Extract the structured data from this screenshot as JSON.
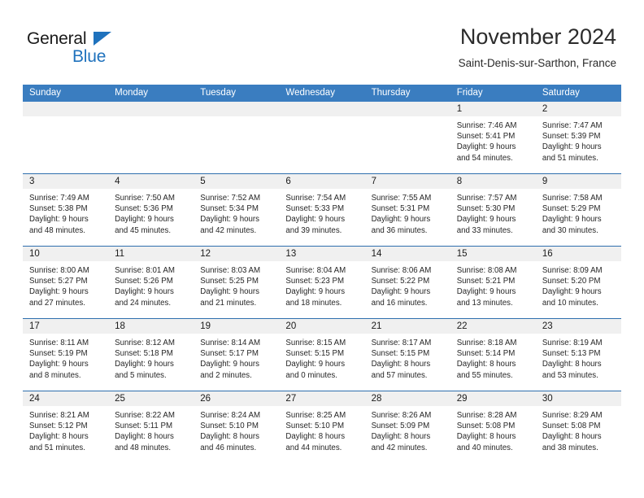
{
  "brand": {
    "line1": "General",
    "line2": "Blue",
    "icon": "triangle-logo"
  },
  "header": {
    "title": "November 2024",
    "subtitle": "Saint-Denis-sur-Sarthon, France"
  },
  "colors": {
    "header_blue": "#3a7dc0",
    "row_divider_blue": "#2f6fae",
    "daynum_band": "#f0f0f0",
    "brand_blue": "#1f72bd",
    "text": "#262626"
  },
  "calendar": {
    "weekdays": [
      "Sunday",
      "Monday",
      "Tuesday",
      "Wednesday",
      "Thursday",
      "Friday",
      "Saturday"
    ],
    "weeks": [
      [
        {
          "empty": true,
          "day": ""
        },
        {
          "empty": true,
          "day": ""
        },
        {
          "empty": true,
          "day": ""
        },
        {
          "empty": true,
          "day": ""
        },
        {
          "empty": true,
          "day": ""
        },
        {
          "empty": false,
          "day": "1",
          "sunrise": "Sunrise: 7:46 AM",
          "sunset": "Sunset: 5:41 PM",
          "daylight1": "Daylight: 9 hours",
          "daylight2": "and 54 minutes."
        },
        {
          "empty": false,
          "day": "2",
          "sunrise": "Sunrise: 7:47 AM",
          "sunset": "Sunset: 5:39 PM",
          "daylight1": "Daylight: 9 hours",
          "daylight2": "and 51 minutes."
        }
      ],
      [
        {
          "empty": false,
          "day": "3",
          "sunrise": "Sunrise: 7:49 AM",
          "sunset": "Sunset: 5:38 PM",
          "daylight1": "Daylight: 9 hours",
          "daylight2": "and 48 minutes."
        },
        {
          "empty": false,
          "day": "4",
          "sunrise": "Sunrise: 7:50 AM",
          "sunset": "Sunset: 5:36 PM",
          "daylight1": "Daylight: 9 hours",
          "daylight2": "and 45 minutes."
        },
        {
          "empty": false,
          "day": "5",
          "sunrise": "Sunrise: 7:52 AM",
          "sunset": "Sunset: 5:34 PM",
          "daylight1": "Daylight: 9 hours",
          "daylight2": "and 42 minutes."
        },
        {
          "empty": false,
          "day": "6",
          "sunrise": "Sunrise: 7:54 AM",
          "sunset": "Sunset: 5:33 PM",
          "daylight1": "Daylight: 9 hours",
          "daylight2": "and 39 minutes."
        },
        {
          "empty": false,
          "day": "7",
          "sunrise": "Sunrise: 7:55 AM",
          "sunset": "Sunset: 5:31 PM",
          "daylight1": "Daylight: 9 hours",
          "daylight2": "and 36 minutes."
        },
        {
          "empty": false,
          "day": "8",
          "sunrise": "Sunrise: 7:57 AM",
          "sunset": "Sunset: 5:30 PM",
          "daylight1": "Daylight: 9 hours",
          "daylight2": "and 33 minutes."
        },
        {
          "empty": false,
          "day": "9",
          "sunrise": "Sunrise: 7:58 AM",
          "sunset": "Sunset: 5:29 PM",
          "daylight1": "Daylight: 9 hours",
          "daylight2": "and 30 minutes."
        }
      ],
      [
        {
          "empty": false,
          "day": "10",
          "sunrise": "Sunrise: 8:00 AM",
          "sunset": "Sunset: 5:27 PM",
          "daylight1": "Daylight: 9 hours",
          "daylight2": "and 27 minutes."
        },
        {
          "empty": false,
          "day": "11",
          "sunrise": "Sunrise: 8:01 AM",
          "sunset": "Sunset: 5:26 PM",
          "daylight1": "Daylight: 9 hours",
          "daylight2": "and 24 minutes."
        },
        {
          "empty": false,
          "day": "12",
          "sunrise": "Sunrise: 8:03 AM",
          "sunset": "Sunset: 5:25 PM",
          "daylight1": "Daylight: 9 hours",
          "daylight2": "and 21 minutes."
        },
        {
          "empty": false,
          "day": "13",
          "sunrise": "Sunrise: 8:04 AM",
          "sunset": "Sunset: 5:23 PM",
          "daylight1": "Daylight: 9 hours",
          "daylight2": "and 18 minutes."
        },
        {
          "empty": false,
          "day": "14",
          "sunrise": "Sunrise: 8:06 AM",
          "sunset": "Sunset: 5:22 PM",
          "daylight1": "Daylight: 9 hours",
          "daylight2": "and 16 minutes."
        },
        {
          "empty": false,
          "day": "15",
          "sunrise": "Sunrise: 8:08 AM",
          "sunset": "Sunset: 5:21 PM",
          "daylight1": "Daylight: 9 hours",
          "daylight2": "and 13 minutes."
        },
        {
          "empty": false,
          "day": "16",
          "sunrise": "Sunrise: 8:09 AM",
          "sunset": "Sunset: 5:20 PM",
          "daylight1": "Daylight: 9 hours",
          "daylight2": "and 10 minutes."
        }
      ],
      [
        {
          "empty": false,
          "day": "17",
          "sunrise": "Sunrise: 8:11 AM",
          "sunset": "Sunset: 5:19 PM",
          "daylight1": "Daylight: 9 hours",
          "daylight2": "and 8 minutes."
        },
        {
          "empty": false,
          "day": "18",
          "sunrise": "Sunrise: 8:12 AM",
          "sunset": "Sunset: 5:18 PM",
          "daylight1": "Daylight: 9 hours",
          "daylight2": "and 5 minutes."
        },
        {
          "empty": false,
          "day": "19",
          "sunrise": "Sunrise: 8:14 AM",
          "sunset": "Sunset: 5:17 PM",
          "daylight1": "Daylight: 9 hours",
          "daylight2": "and 2 minutes."
        },
        {
          "empty": false,
          "day": "20",
          "sunrise": "Sunrise: 8:15 AM",
          "sunset": "Sunset: 5:15 PM",
          "daylight1": "Daylight: 9 hours",
          "daylight2": "and 0 minutes."
        },
        {
          "empty": false,
          "day": "21",
          "sunrise": "Sunrise: 8:17 AM",
          "sunset": "Sunset: 5:15 PM",
          "daylight1": "Daylight: 8 hours",
          "daylight2": "and 57 minutes."
        },
        {
          "empty": false,
          "day": "22",
          "sunrise": "Sunrise: 8:18 AM",
          "sunset": "Sunset: 5:14 PM",
          "daylight1": "Daylight: 8 hours",
          "daylight2": "and 55 minutes."
        },
        {
          "empty": false,
          "day": "23",
          "sunrise": "Sunrise: 8:19 AM",
          "sunset": "Sunset: 5:13 PM",
          "daylight1": "Daylight: 8 hours",
          "daylight2": "and 53 minutes."
        }
      ],
      [
        {
          "empty": false,
          "day": "24",
          "sunrise": "Sunrise: 8:21 AM",
          "sunset": "Sunset: 5:12 PM",
          "daylight1": "Daylight: 8 hours",
          "daylight2": "and 51 minutes."
        },
        {
          "empty": false,
          "day": "25",
          "sunrise": "Sunrise: 8:22 AM",
          "sunset": "Sunset: 5:11 PM",
          "daylight1": "Daylight: 8 hours",
          "daylight2": "and 48 minutes."
        },
        {
          "empty": false,
          "day": "26",
          "sunrise": "Sunrise: 8:24 AM",
          "sunset": "Sunset: 5:10 PM",
          "daylight1": "Daylight: 8 hours",
          "daylight2": "and 46 minutes."
        },
        {
          "empty": false,
          "day": "27",
          "sunrise": "Sunrise: 8:25 AM",
          "sunset": "Sunset: 5:10 PM",
          "daylight1": "Daylight: 8 hours",
          "daylight2": "and 44 minutes."
        },
        {
          "empty": false,
          "day": "28",
          "sunrise": "Sunrise: 8:26 AM",
          "sunset": "Sunset: 5:09 PM",
          "daylight1": "Daylight: 8 hours",
          "daylight2": "and 42 minutes."
        },
        {
          "empty": false,
          "day": "29",
          "sunrise": "Sunrise: 8:28 AM",
          "sunset": "Sunset: 5:08 PM",
          "daylight1": "Daylight: 8 hours",
          "daylight2": "and 40 minutes."
        },
        {
          "empty": false,
          "day": "30",
          "sunrise": "Sunrise: 8:29 AM",
          "sunset": "Sunset: 5:08 PM",
          "daylight1": "Daylight: 8 hours",
          "daylight2": "and 38 minutes."
        }
      ]
    ]
  }
}
